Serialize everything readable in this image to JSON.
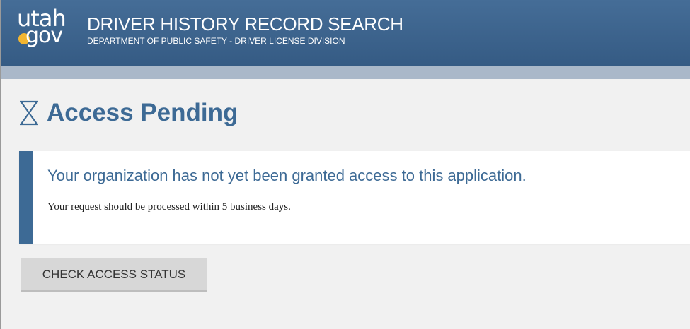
{
  "header": {
    "logo_text_top": "utah",
    "logo_text_bottom": "gov",
    "app_title": "DRIVER HISTORY RECORD SEARCH",
    "app_subtitle": "DEPARTMENT OF PUBLIC SAFETY - DRIVER LICENSE DIVISION"
  },
  "page": {
    "title": "Access Pending",
    "title_icon": "hourglass-icon"
  },
  "alert": {
    "heading": "Your organization has not yet been granted access to this application.",
    "message": "Your request should be processed within 5 business days."
  },
  "actions": {
    "check_status_label": "CHECK ACCESS STATUS"
  },
  "colors": {
    "header_bg": "#3f6690",
    "accent_blue": "#3d6a95",
    "logo_dot": "#f2b531",
    "button_bg": "#d7d7d7",
    "page_bg": "#f1f1f1"
  }
}
